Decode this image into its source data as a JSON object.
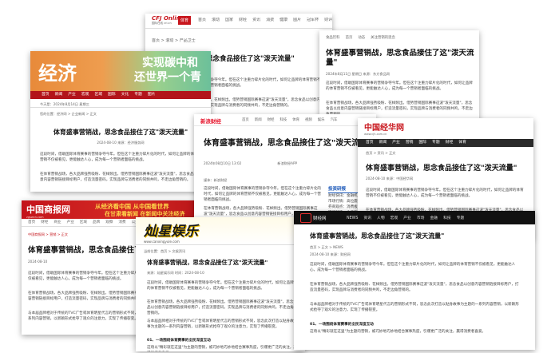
{
  "common": {
    "headline": "体育盛事营销战，思念食品接住了这\"泼天流量\"",
    "p1": "这段时间，借助国际体育赛事的营销争夺今年。但在这个注重力碎片化的时代，如何让品牌的体育营销不仅被看见，更能触达人心，成为每一个营销者面临的挑战。",
    "p2": "在体育营销战场，各大品牌强势吸粉、花样频出。借势营销国际赛事这波\"泼天流量\"，思念食品以创意内容营销链接目标用户，打造流量密码，实现品牌与消费者的同频共鸣，不走边角营销的。",
    "p3": "与本届品牌相对于传统的TVC广告或体育明星代言的营销形式不同，思念此次打造以贴身故事为主题的一系列内容营销，以新颖形式抢夺了观众的注意力，实现了传播裂变。",
    "section": "01、一场围绕体育赛事的全民深度互动",
    "p4": "这场以\"精彩就在这里\"为主题的营销，被巧妙地巧妙地结合赛事热度，引爆更广泛的关注，赢得消费者喜爱。"
  },
  "cards": {
    "cfj": {
      "logo": "CFJ Online",
      "logo_sub": "国际在线 cri.cn",
      "tag": "体育",
      "nav": [
        "首页",
        "滚动",
        "国家",
        "财经",
        "资讯",
        "消费",
        "健康",
        "图片",
        "冠军杯",
        "财评"
      ],
      "breadcrumb": "首页 > 滚动 > 产品卫士",
      "date": "2024-08-10 10:32"
    },
    "dongfang": {
      "nav": [
        "食品饮料",
        "首页",
        "动态",
        "关注营销的思念"
      ],
      "meta": "2024年8月11日 星期日  来源：东方食品网"
    },
    "jingji": {
      "logo": "经济",
      "banner_line1": "实现碳中和",
      "banner_line2": "还世界一个青",
      "nav": [
        "首页",
        "新闻",
        "产业",
        "宏观",
        "区域",
        "国际",
        "文化",
        "专题",
        "图片"
      ],
      "date_bar": "今天是：2024年8月14日 星期三",
      "breadcrumb": "您的位置：经济网 > 企业新闻 > 正文",
      "date": "2024-08-10 来源：经济服务网"
    },
    "sina": {
      "logo": "新浪财经",
      "nav": [
        "首页",
        "新闻",
        "财经",
        "科技",
        "体育",
        "视频",
        "娱乐",
        "汽车"
      ],
      "meta": "2024年08月10日 13:02",
      "app": "新浪财经APP",
      "media": "媒体：新浪财经",
      "side_title": "投资研报",
      "side_items": [
        "财经快讯：金融机构对接",
        "市场行情：高位震荡走势",
        "券商观点：消费板块复苏",
        "研报精选：食品饮料行业"
      ]
    },
    "cnjinghua": {
      "logo": "中国经华网",
      "logo_sub": "www.cjh.com.cn",
      "nav": [
        "首页",
        "新闻",
        "产业",
        "营销",
        "国际",
        "专题",
        "财经",
        "体育"
      ],
      "breadcrumb": "首页 > 资讯 > 正文",
      "date": "2024-08-10 来源：中国经华网"
    },
    "cnbusiness": {
      "logo": "中国商报网",
      "logo_sub": "zgswcn.com",
      "banner_line1": "从经济看中国 从中国看世界",
      "banner_line2": "在甘肃看新闻 在新闻中关注经济",
      "nav": [
        "首页",
        "财经",
        "商业",
        "产业",
        "区域",
        "品牌",
        "观察",
        "消费",
        "公益"
      ],
      "breadcrumb": "中国商报网 > 营销 > 正文",
      "date": "2024-08-10"
    },
    "zhaoqu": {
      "logo": "灿星娱乐",
      "logo_sub": "www.canxingyule.com",
      "breadcrumb": "当前位置：首页 > 文娱资讯",
      "meta": "来源：灿星娱乐网  时间：2024-08-10"
    },
    "dark": {
      "logo": "财经网",
      "nav": [
        "NEWS",
        "资讯",
        "人物",
        "宏观",
        "产业",
        "市场",
        "金融",
        "科技",
        "专题"
      ],
      "breadcrumb": "首页 > 正文 > NEWS",
      "meta": "2024-08-10  来源：财经网"
    }
  }
}
